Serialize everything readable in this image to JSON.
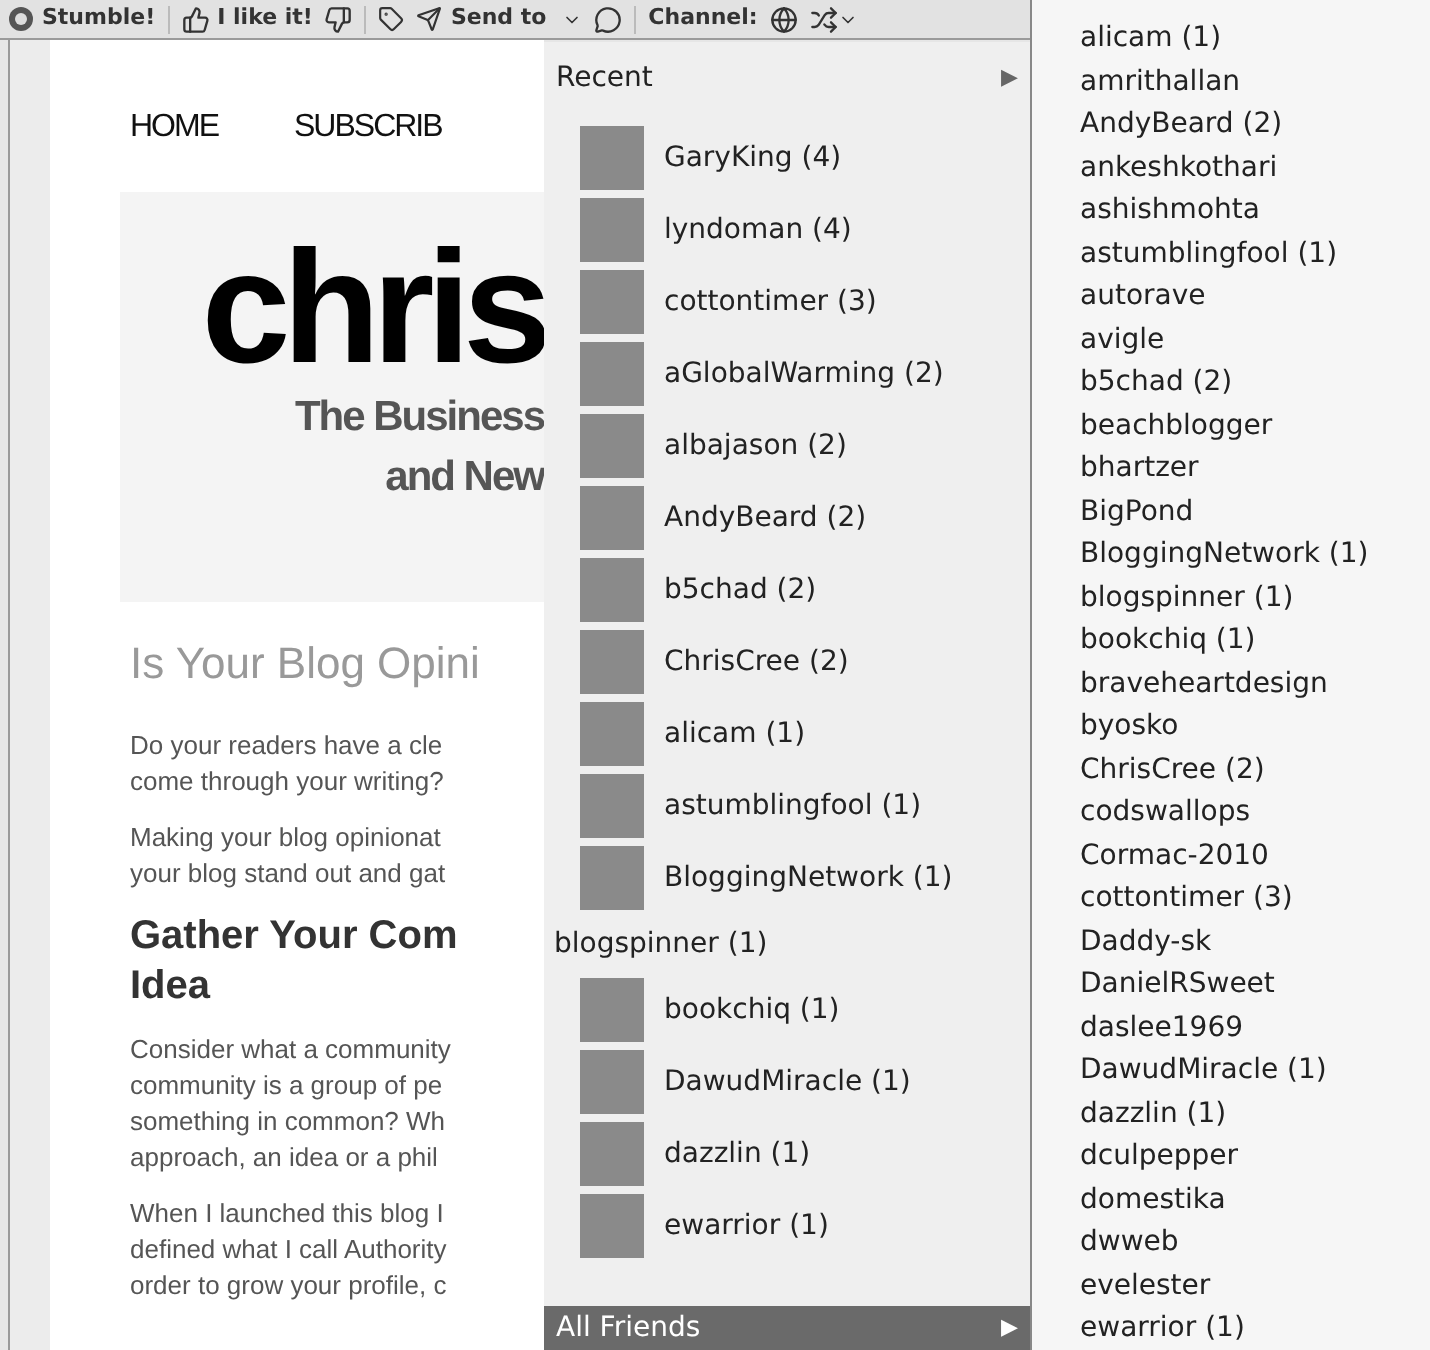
{
  "toolbar": {
    "stumble": "Stumble!",
    "like": "I like it!",
    "send_to": "Send to",
    "channel": "Channel:"
  },
  "page": {
    "nav": [
      "HOME",
      "SUBSCRIB"
    ],
    "banner": {
      "logo": "chris",
      "tagline": [
        "The Business",
        "and New"
      ]
    },
    "title": "Is Your Blog Opini",
    "blocks": [
      {
        "kind": "para",
        "lines": [
          "Do your readers have a cle",
          "come through your writing?"
        ]
      },
      {
        "kind": "para",
        "lines": [
          "Making your blog opinionat",
          "your blog stand out and gat"
        ]
      },
      {
        "kind": "heading",
        "lines": [
          "Gather Your Com",
          "Idea"
        ]
      },
      {
        "kind": "para",
        "lines": [
          "Consider what a community",
          "community is a group of pe",
          "something in common? Wh",
          "approach, an idea or a phil"
        ]
      },
      {
        "kind": "para",
        "lines": [
          "When I launched this blog I",
          "defined what I call Authority",
          "order to grow your profile, c"
        ]
      }
    ]
  },
  "send_menu": {
    "recent": "Recent",
    "recent_arrow": "▶",
    "items": [
      {
        "name": "GaryKing (4)",
        "kind": "photo"
      },
      {
        "name": "lyndoman (4)",
        "kind": "photo"
      },
      {
        "name": "cottontimer (3)",
        "kind": "photo"
      },
      {
        "name": "aGlobalWarming (2)",
        "kind": "photo"
      },
      {
        "name": "albajason (2)",
        "kind": "photo"
      },
      {
        "name": "AndyBeard (2)",
        "kind": "photo"
      },
      {
        "name": "b5chad (2)",
        "kind": "photo"
      },
      {
        "name": "ChrisCree (2)",
        "kind": "photo"
      },
      {
        "name": "alicam (1)",
        "kind": "photo"
      },
      {
        "name": "astumblingfool (1)",
        "kind": "photo"
      },
      {
        "name": "BloggingNetwork (1)",
        "kind": "photo"
      },
      {
        "name": "blogspinner (1)",
        "kind": "plain"
      },
      {
        "name": "bookchiq (1)",
        "kind": "photo"
      },
      {
        "name": "DawudMiracle (1)",
        "kind": "photo"
      },
      {
        "name": "dazzlin (1)",
        "kind": "photo"
      },
      {
        "name": "ewarrior (1)",
        "kind": "photo"
      }
    ],
    "all_friends": "All Friends",
    "all_friends_arrow": "▶"
  },
  "friends_list": [
    "alicam (1)",
    "amrithallan",
    "AndyBeard (2)",
    "ankeshkothari",
    "ashishmohta",
    "astumblingfool (1)",
    "autorave",
    "avigle",
    "b5chad (2)",
    "beachblogger",
    "bhartzer",
    "BigPond",
    "BloggingNetwork (1)",
    "blogspinner (1)",
    "bookchiq (1)",
    "braveheartdesign",
    "byosko",
    "ChrisCree (2)",
    "codswallops",
    "Cormac-2010",
    "cottontimer (3)",
    "Daddy-sk",
    "DanielRSweet",
    "daslee1969",
    "DawudMiracle (1)",
    "dazzlin (1)",
    "dculpepper",
    "domestika",
    "dwweb",
    "evelester",
    "ewarrior (1)"
  ]
}
